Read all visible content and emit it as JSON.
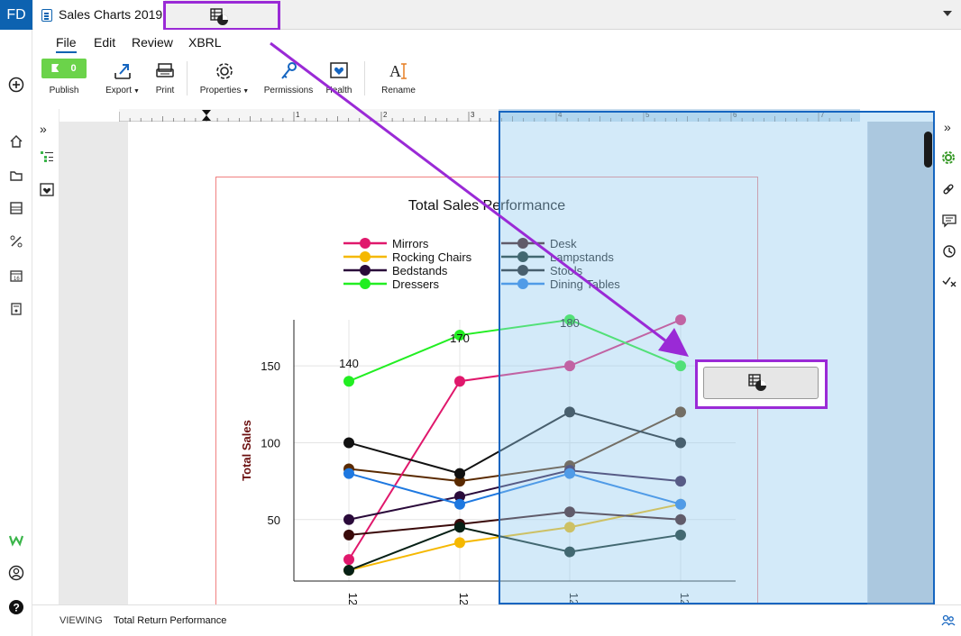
{
  "app": {
    "badge": "FD",
    "document_title": "Sales Charts 2019"
  },
  "menu": [
    "File",
    "Edit",
    "Review",
    "XBRL"
  ],
  "toolbar": {
    "publish_count": "0",
    "publish_label": "Publish",
    "export_label": "Export",
    "print_label": "Print",
    "properties_label": "Properties",
    "permissions_label": "Permissions",
    "health_label": "Health",
    "rename_label": "Rename"
  },
  "ruler": {
    "ticks": [
      "1",
      "2",
      "3",
      "4",
      "5",
      "6",
      "7"
    ]
  },
  "status": {
    "mode": "VIEWING",
    "section": "Total Return Performance"
  },
  "colors": {
    "accent": "#0d62b0",
    "highlight": "#9a2ad6",
    "publish": "#6bd34a",
    "selection_border": "#1565c0"
  },
  "left_rail_icons": [
    "add-icon",
    "home-icon",
    "folder-icon",
    "layers-icon",
    "percent-icon",
    "calendar-icon",
    "calculator-icon",
    "workiva-logo-icon",
    "user-icon",
    "help-icon"
  ],
  "right_rail_icons": [
    "collapse-right-icon",
    "gear-icon",
    "link-icon",
    "comment-icon",
    "history-icon",
    "check-icon"
  ],
  "chart_data": {
    "type": "line",
    "title": "Total Sales Performance",
    "ylabel": "Total Sales",
    "xlabel": "",
    "categories": [
      "12",
      "12",
      "12",
      "12"
    ],
    "ylim": [
      10,
      180
    ],
    "yticks": [
      50,
      100,
      150
    ],
    "grid": true,
    "legend_position": "top",
    "series": [
      {
        "name": "Mirrors",
        "color": "#e0186c",
        "values": [
          24,
          140,
          150,
          180
        ]
      },
      {
        "name": "Rocking Chairs",
        "color": "#f5b800",
        "values": [
          17,
          35,
          45,
          60
        ]
      },
      {
        "name": "Bedstands",
        "color": "#2a0a3a",
        "values": [
          50,
          65,
          82,
          75
        ]
      },
      {
        "name": "Dressers",
        "color": "#22ee22",
        "values": [
          140,
          170,
          180,
          150
        ]
      },
      {
        "name": "Desk",
        "color": "#3a0a0a",
        "values": [
          40,
          47,
          55,
          50
        ]
      },
      {
        "name": "Lampstands",
        "color": "#062015",
        "values": [
          17,
          45,
          29,
          40
        ]
      },
      {
        "name": "Stools",
        "color": "#111111",
        "values": [
          100,
          80,
          120,
          100
        ]
      },
      {
        "name": "Dining Tables",
        "color": "#1e78e0",
        "values": [
          80,
          60,
          80,
          60
        ]
      }
    ],
    "extra_lines": [
      {
        "color": "#5a2a00",
        "values": [
          83,
          75,
          85,
          120
        ]
      }
    ],
    "data_labels": [
      {
        "series": "Dressers",
        "index": 0,
        "text": "140"
      },
      {
        "series": "Dressers",
        "index": 1,
        "text": "170"
      },
      {
        "series": "Dressers",
        "index": 2,
        "text": "180"
      }
    ]
  }
}
